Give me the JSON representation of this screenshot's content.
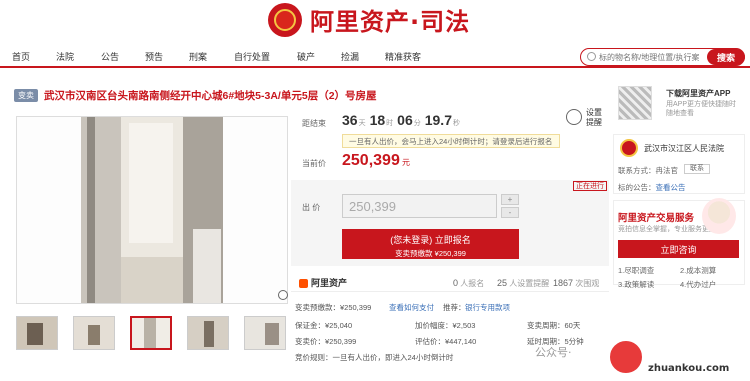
{
  "header": {
    "logo_text": "阿里资产·司法",
    "search_placeholder": "标的物名称/地理位置/执行案号",
    "search_button": "搜索"
  },
  "nav": {
    "items": [
      "首页",
      "法院",
      "公告",
      "预告",
      "刑案",
      "自行处置",
      "破产",
      "捡漏",
      "精准获客"
    ]
  },
  "item": {
    "badge": "变卖",
    "title": "武汉市汉南区台头南路南侧经开中心城6#地块5-3A/单元5层（2）号房屋"
  },
  "auction": {
    "countdown_label": "距结束",
    "countdown": {
      "days": "36",
      "days_unit": "天",
      "hours": "18",
      "hours_unit": "时",
      "minutes": "06",
      "minutes_unit": "分",
      "seconds": "19.7",
      "seconds_unit": "秒"
    },
    "remind_label": "设置提醒",
    "notice": "一旦有人出价，会马上进入24小时倒计时；请登录后进行报名",
    "price_label": "当前价",
    "price": "250,399",
    "price_unit": "元",
    "status": "正在进行",
    "bid_label": "出 价",
    "bid_value": "250,399",
    "stepper_plus": "+",
    "stepper_minus": "-",
    "signup_main": "(您未登录) 立即报名",
    "signup_sub": "变卖预缴款 ¥250,399"
  },
  "stats": {
    "ali_label": "阿里资产",
    "signups": "0",
    "signups_label": "人报名",
    "reminders": "25",
    "reminders_label": "人设置提醒",
    "views": "1867",
    "views_label": "次围观"
  },
  "details": {
    "deposit_label": "变卖预缴款",
    "deposit_value": "¥250,399",
    "deposit_link": "查看如何支付",
    "recommend_label": "推荐：",
    "recommend_link": "银行专用款项",
    "guarantee_label": "保证金：",
    "guarantee_value": "¥25,040",
    "increment_label": "加价幅度：",
    "increment_value": "¥2,503",
    "period_label": "变卖周期：",
    "period_value": "60天",
    "sale_label": "变卖价：",
    "sale_value": "¥250,399",
    "assess_label": "评估价：",
    "assess_value": "¥447,140",
    "delay_label": "延时周期：",
    "delay_value": "5分钟",
    "rule_label": "竞价规则：",
    "rule_value": "一旦有人出价，即进入24小时倒计时"
  },
  "sidebar": {
    "app_title": "下载阿里资产APP",
    "app_sub": "用APP更方便快捷随时随地查看",
    "court_name": "武汉市汉江区人民法院",
    "contact_label": "联系方式：",
    "contact_name": "冉法官",
    "contact_button": "联系",
    "owner_label": "标的公告：",
    "owner_link": "查看公告",
    "service_title": "阿里资产交易服务",
    "service_sub": "竞拍信息全掌握，专业服务更放心",
    "consult_button": "立即咨询",
    "services": [
      "1.尽职调查",
      "2.成本测算",
      "3.政策解读",
      "4.代办过户"
    ]
  },
  "watermark": {
    "wechat": "公众号·",
    "brand": "沌口之声",
    "url": "zhuankou.com"
  }
}
